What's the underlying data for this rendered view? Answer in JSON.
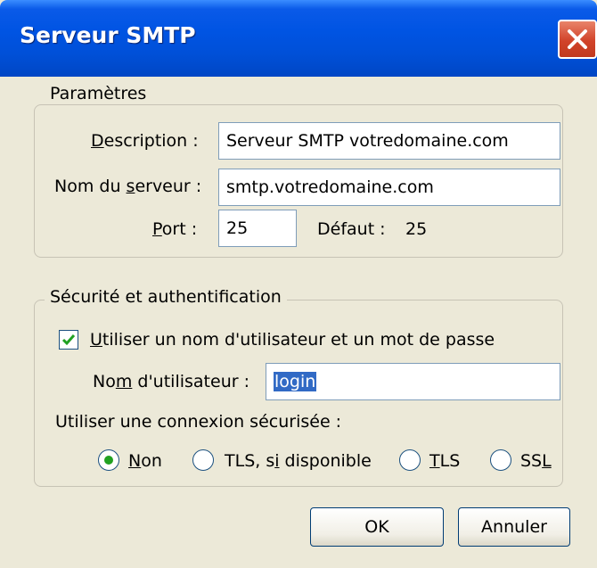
{
  "window": {
    "title": "Serveur SMTP"
  },
  "params": {
    "legend": "Paramètres",
    "description_label": "Description :",
    "description_value": "Serveur SMTP votredomaine.com",
    "server_label": "Nom du serveur :",
    "server_value": "smtp.votredomaine.com",
    "port_label": "Port :",
    "port_value": "25",
    "default_label": "Défaut :",
    "default_value": "25"
  },
  "security": {
    "legend": "Sécurité et authentification",
    "use_auth_label": "Utiliser un nom d'utilisateur et un mot de passe",
    "use_auth_checked": true,
    "username_label": "Nom d'utilisateur :",
    "username_value": "login",
    "secure_conn_label": "Utiliser une connexion sécurisée :",
    "options": [
      {
        "label": "Non",
        "selected": true
      },
      {
        "label": "TLS, si disponible",
        "selected": false
      },
      {
        "label": "TLS",
        "selected": false
      },
      {
        "label": "SSL",
        "selected": false
      }
    ]
  },
  "buttons": {
    "ok": "OK",
    "cancel": "Annuler"
  },
  "colors": {
    "titlebar": "#0054e3",
    "dialog_bg": "#ece9d8",
    "selection": "#316ac5",
    "check": "#21a121",
    "close": "#d1432a"
  },
  "icons": {
    "close": "close-icon",
    "check": "checkmark-icon"
  }
}
